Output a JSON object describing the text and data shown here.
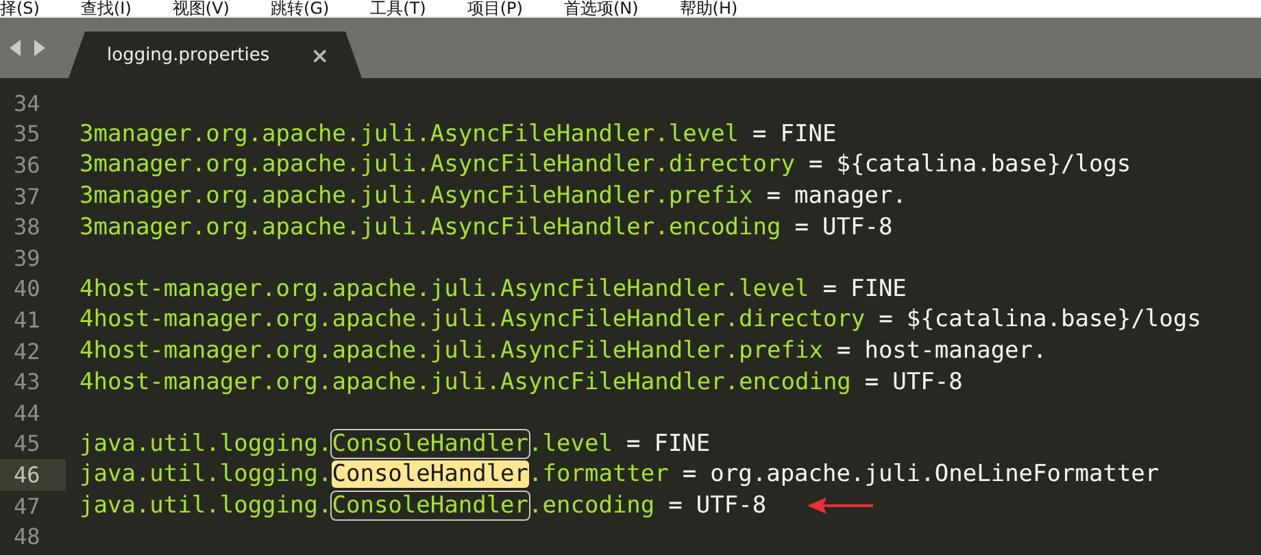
{
  "menu": [
    "择(S)",
    "查找(I)",
    "视图(V)",
    "跳转(G)",
    "工具(T)",
    "项目(P)",
    "首选项(N)",
    "帮助(H)"
  ],
  "tabs": [
    {
      "label": "logging.properties",
      "selected": true,
      "close": "×"
    }
  ],
  "lines": [
    {
      "number": "34",
      "current": false,
      "marked": false
    },
    {
      "number": "35",
      "current": false,
      "marked": false,
      "segments": [
        {
          "text": "3manager.org.apache.juli.AsyncFileHandler.level",
          "outlined": false,
          "selected": false
        }
      ],
      "operator": "=",
      "value": "FINE"
    },
    {
      "number": "36",
      "current": false,
      "marked": false,
      "segments": [
        {
          "text": "3manager.org.apache.juli.AsyncFileHandler.directory",
          "outlined": false,
          "selected": false
        }
      ],
      "operator": "=",
      "value": "${catalina.base}/logs"
    },
    {
      "number": "37",
      "current": false,
      "marked": false,
      "segments": [
        {
          "text": "3manager.org.apache.juli.AsyncFileHandler.prefix",
          "outlined": false,
          "selected": false
        }
      ],
      "operator": "=",
      "value": "manager."
    },
    {
      "number": "38",
      "current": false,
      "marked": false,
      "segments": [
        {
          "text": "3manager.org.apache.juli.AsyncFileHandler.encoding",
          "outlined": false,
          "selected": false
        }
      ],
      "operator": "=",
      "value": "UTF-8"
    },
    {
      "number": "39",
      "current": false,
      "marked": false
    },
    {
      "number": "40",
      "current": false,
      "marked": false,
      "segments": [
        {
          "text": "4host-manager.org.apache.juli.AsyncFileHandler.level",
          "outlined": false,
          "selected": false
        }
      ],
      "operator": "=",
      "value": "FINE"
    },
    {
      "number": "41",
      "current": false,
      "marked": false,
      "segments": [
        {
          "text": "4host-manager.org.apache.juli.AsyncFileHandler.directory",
          "outlined": false,
          "selected": false
        }
      ],
      "operator": "=",
      "value": "${catalina.base}/logs"
    },
    {
      "number": "42",
      "current": false,
      "marked": false,
      "segments": [
        {
          "text": "4host-manager.org.apache.juli.AsyncFileHandler.prefix",
          "outlined": false,
          "selected": false
        }
      ],
      "operator": "=",
      "value": "host-manager."
    },
    {
      "number": "43",
      "current": false,
      "marked": false,
      "segments": [
        {
          "text": "4host-manager.org.apache.juli.AsyncFileHandler.encoding",
          "outlined": false,
          "selected": false
        }
      ],
      "operator": "=",
      "value": "UTF-8"
    },
    {
      "number": "44",
      "current": false,
      "marked": false
    },
    {
      "number": "45",
      "current": false,
      "marked": false,
      "segments": [
        {
          "text": "java.util.logging.",
          "outlined": false,
          "selected": false
        },
        {
          "text": "ConsoleHandler",
          "outlined": true,
          "selected": false
        },
        {
          "text": ".level",
          "outlined": false,
          "selected": false
        }
      ],
      "operator": "=",
      "value": "FINE"
    },
    {
      "number": "46",
      "current": true,
      "marked": false,
      "segments": [
        {
          "text": "java.util.logging.",
          "outlined": false,
          "selected": false
        },
        {
          "text": "ConsoleHandler",
          "outlined": false,
          "selected": true
        },
        {
          "text": ".formatter",
          "outlined": false,
          "selected": false
        }
      ],
      "operator": "=",
      "value": "org.apache.juli.OneLineFormatter"
    },
    {
      "number": "47",
      "current": false,
      "marked": true,
      "segments": [
        {
          "text": "java.util.logging.",
          "outlined": false,
          "selected": false
        },
        {
          "text": "ConsoleHandler",
          "outlined": true,
          "selected": false
        },
        {
          "text": ".encoding",
          "outlined": false,
          "selected": false
        }
      ],
      "operator": "=",
      "value": "UTF-8"
    },
    {
      "number": "48",
      "current": false,
      "marked": false
    }
  ]
}
